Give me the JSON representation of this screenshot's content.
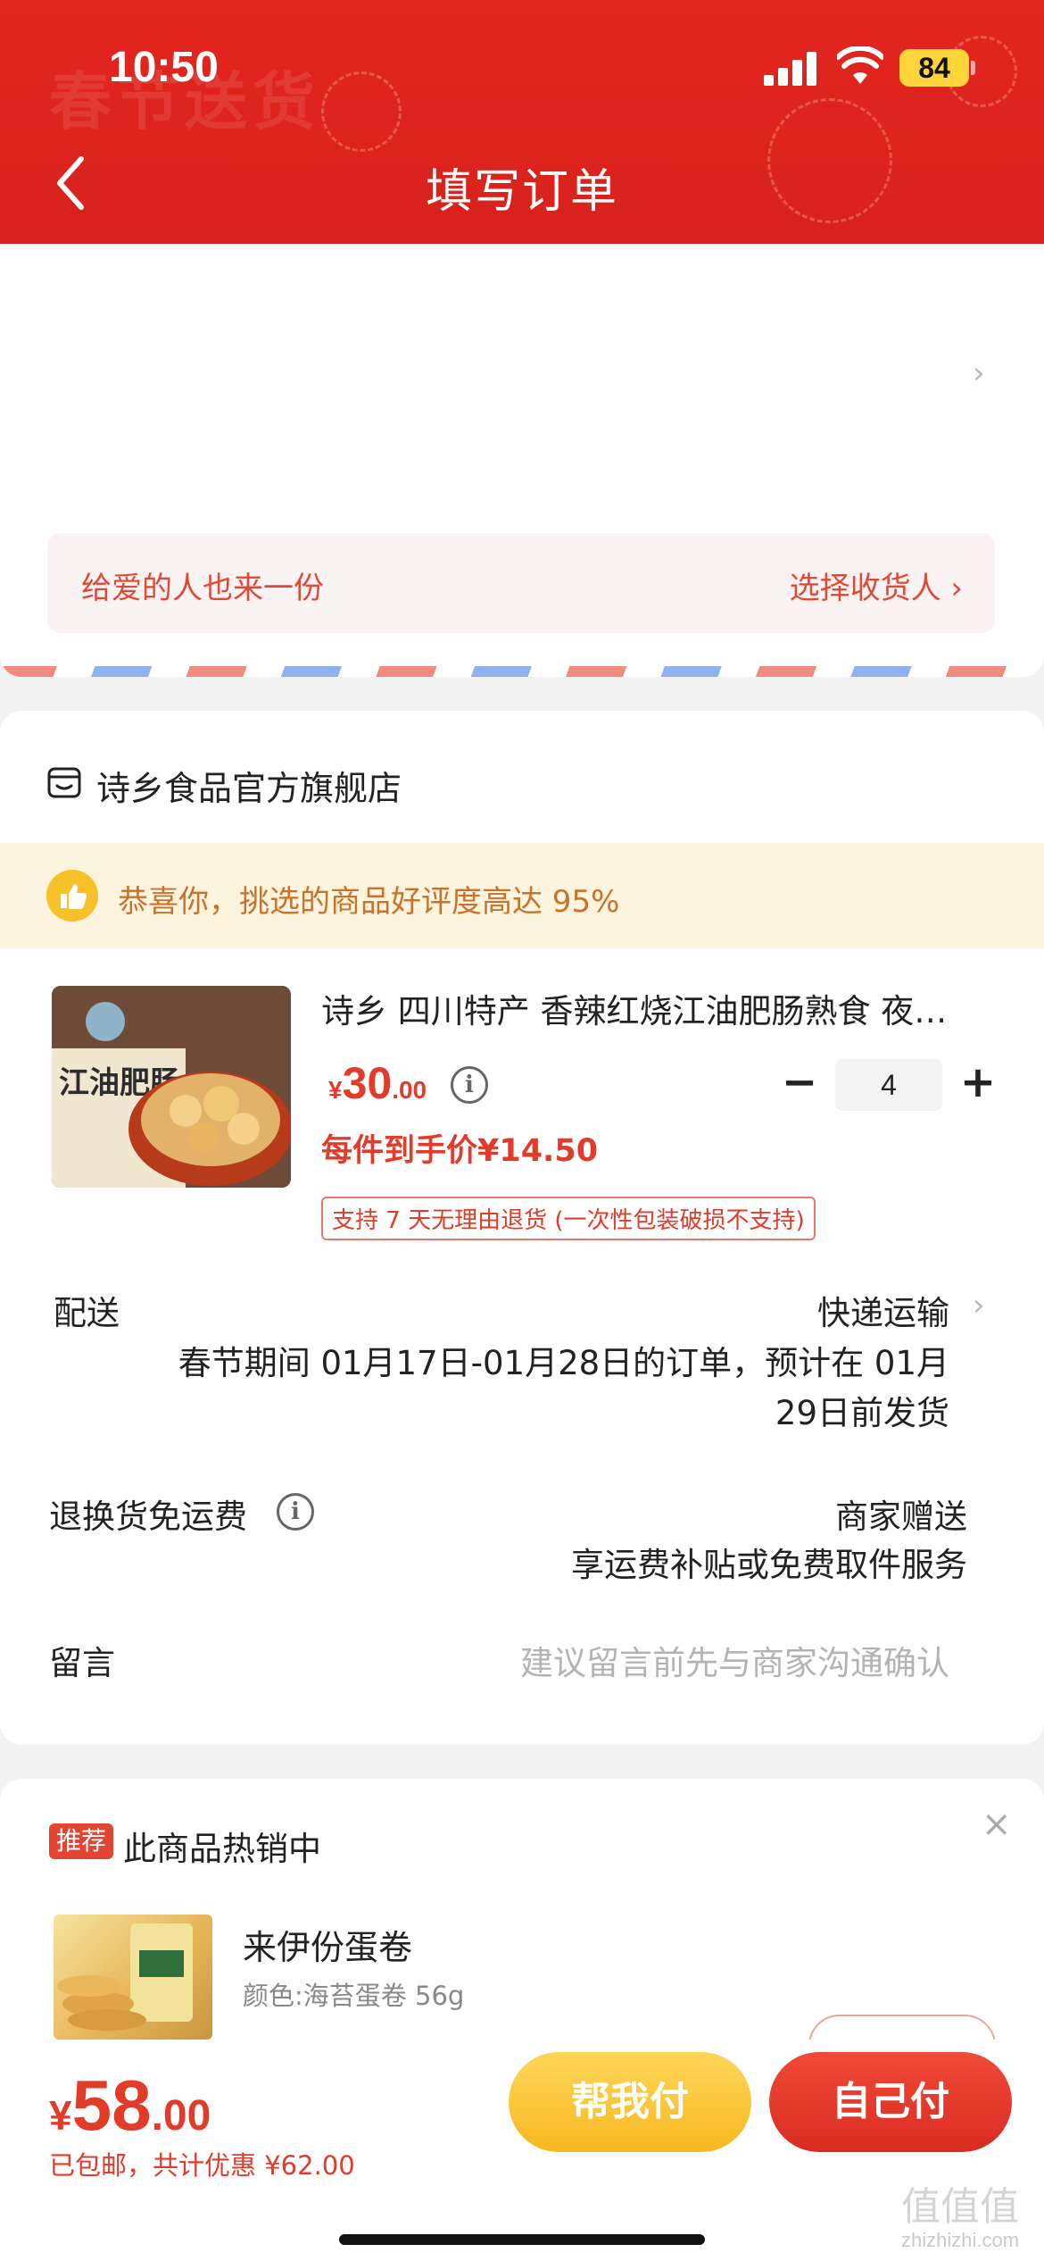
{
  "status_bar": {
    "time": "10:50",
    "battery": "84"
  },
  "header": {
    "decor_text": "春节送货",
    "title": "填写订单"
  },
  "address": {
    "gift_left": "给爱的人也来一份",
    "gift_right": "选择收货人 ›"
  },
  "shop": {
    "name": "诗乡食品官方旗舰店",
    "praise": "恭喜你，挑选的商品好评度高达 95%"
  },
  "product": {
    "title": "诗乡 四川特产 香辣红烧江油肥肠熟食 夜…",
    "image_label": "江油肥肠",
    "price_symbol": "¥",
    "price_int": "30",
    "price_dec": ".00",
    "quantity": "4",
    "unit_price": "每件到手价¥14.50",
    "return_policy": "支持 7 天无理由退货 (一次性包装破损不支持)"
  },
  "delivery": {
    "label": "配送",
    "method": "快递运输",
    "note_line1": "春节期间 01月17日-01月28日的订单，预计在 01月",
    "note_line2": "29日前发货"
  },
  "return_shipping": {
    "label": "退换货免运费",
    "value_line1": "商家赠送",
    "value_line2": "享运费补贴或免费取件服务"
  },
  "note": {
    "label": "留言",
    "placeholder": "建议留言前先与商家沟通确认"
  },
  "recommendation": {
    "badge": "推荐",
    "title": "此商品热销中",
    "item_name": "来伊份蛋卷",
    "item_spec": "颜色:海苔蛋卷 56g"
  },
  "checkout": {
    "total_symbol": "¥",
    "total_int": "58",
    "total_dec": ".00",
    "total_note": "已包邮，共计优惠 ¥62.00",
    "help_pay": "帮我付",
    "self_pay": "自己付"
  },
  "watermark": {
    "line1": "值值值",
    "line2": "zhizhizhi.com"
  },
  "colors": {
    "header_red": "#e3261f",
    "price_red": "#e33b2a",
    "help_pay_yellow": "#f6b820",
    "self_pay_red": "#d92c21",
    "praise_bg": "#fdf4dd"
  }
}
